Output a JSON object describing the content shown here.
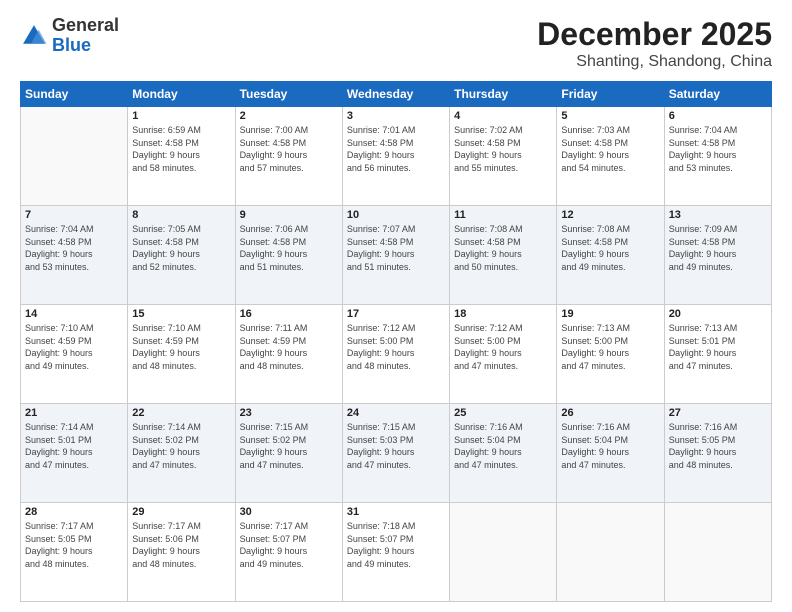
{
  "header": {
    "logo_general": "General",
    "logo_blue": "Blue",
    "main_title": "December 2025",
    "subtitle": "Shanting, Shandong, China"
  },
  "columns": [
    "Sunday",
    "Monday",
    "Tuesday",
    "Wednesday",
    "Thursday",
    "Friday",
    "Saturday"
  ],
  "weeks": [
    [
      {
        "day": "",
        "info": ""
      },
      {
        "day": "1",
        "info": "Sunrise: 6:59 AM\nSunset: 4:58 PM\nDaylight: 9 hours\nand 58 minutes."
      },
      {
        "day": "2",
        "info": "Sunrise: 7:00 AM\nSunset: 4:58 PM\nDaylight: 9 hours\nand 57 minutes."
      },
      {
        "day": "3",
        "info": "Sunrise: 7:01 AM\nSunset: 4:58 PM\nDaylight: 9 hours\nand 56 minutes."
      },
      {
        "day": "4",
        "info": "Sunrise: 7:02 AM\nSunset: 4:58 PM\nDaylight: 9 hours\nand 55 minutes."
      },
      {
        "day": "5",
        "info": "Sunrise: 7:03 AM\nSunset: 4:58 PM\nDaylight: 9 hours\nand 54 minutes."
      },
      {
        "day": "6",
        "info": "Sunrise: 7:04 AM\nSunset: 4:58 PM\nDaylight: 9 hours\nand 53 minutes."
      }
    ],
    [
      {
        "day": "7",
        "info": "Sunrise: 7:04 AM\nSunset: 4:58 PM\nDaylight: 9 hours\nand 53 minutes."
      },
      {
        "day": "8",
        "info": "Sunrise: 7:05 AM\nSunset: 4:58 PM\nDaylight: 9 hours\nand 52 minutes."
      },
      {
        "day": "9",
        "info": "Sunrise: 7:06 AM\nSunset: 4:58 PM\nDaylight: 9 hours\nand 51 minutes."
      },
      {
        "day": "10",
        "info": "Sunrise: 7:07 AM\nSunset: 4:58 PM\nDaylight: 9 hours\nand 51 minutes."
      },
      {
        "day": "11",
        "info": "Sunrise: 7:08 AM\nSunset: 4:58 PM\nDaylight: 9 hours\nand 50 minutes."
      },
      {
        "day": "12",
        "info": "Sunrise: 7:08 AM\nSunset: 4:58 PM\nDaylight: 9 hours\nand 49 minutes."
      },
      {
        "day": "13",
        "info": "Sunrise: 7:09 AM\nSunset: 4:58 PM\nDaylight: 9 hours\nand 49 minutes."
      }
    ],
    [
      {
        "day": "14",
        "info": "Sunrise: 7:10 AM\nSunset: 4:59 PM\nDaylight: 9 hours\nand 49 minutes."
      },
      {
        "day": "15",
        "info": "Sunrise: 7:10 AM\nSunset: 4:59 PM\nDaylight: 9 hours\nand 48 minutes."
      },
      {
        "day": "16",
        "info": "Sunrise: 7:11 AM\nSunset: 4:59 PM\nDaylight: 9 hours\nand 48 minutes."
      },
      {
        "day": "17",
        "info": "Sunrise: 7:12 AM\nSunset: 5:00 PM\nDaylight: 9 hours\nand 48 minutes."
      },
      {
        "day": "18",
        "info": "Sunrise: 7:12 AM\nSunset: 5:00 PM\nDaylight: 9 hours\nand 47 minutes."
      },
      {
        "day": "19",
        "info": "Sunrise: 7:13 AM\nSunset: 5:00 PM\nDaylight: 9 hours\nand 47 minutes."
      },
      {
        "day": "20",
        "info": "Sunrise: 7:13 AM\nSunset: 5:01 PM\nDaylight: 9 hours\nand 47 minutes."
      }
    ],
    [
      {
        "day": "21",
        "info": "Sunrise: 7:14 AM\nSunset: 5:01 PM\nDaylight: 9 hours\nand 47 minutes."
      },
      {
        "day": "22",
        "info": "Sunrise: 7:14 AM\nSunset: 5:02 PM\nDaylight: 9 hours\nand 47 minutes."
      },
      {
        "day": "23",
        "info": "Sunrise: 7:15 AM\nSunset: 5:02 PM\nDaylight: 9 hours\nand 47 minutes."
      },
      {
        "day": "24",
        "info": "Sunrise: 7:15 AM\nSunset: 5:03 PM\nDaylight: 9 hours\nand 47 minutes."
      },
      {
        "day": "25",
        "info": "Sunrise: 7:16 AM\nSunset: 5:04 PM\nDaylight: 9 hours\nand 47 minutes."
      },
      {
        "day": "26",
        "info": "Sunrise: 7:16 AM\nSunset: 5:04 PM\nDaylight: 9 hours\nand 47 minutes."
      },
      {
        "day": "27",
        "info": "Sunrise: 7:16 AM\nSunset: 5:05 PM\nDaylight: 9 hours\nand 48 minutes."
      }
    ],
    [
      {
        "day": "28",
        "info": "Sunrise: 7:17 AM\nSunset: 5:05 PM\nDaylight: 9 hours\nand 48 minutes."
      },
      {
        "day": "29",
        "info": "Sunrise: 7:17 AM\nSunset: 5:06 PM\nDaylight: 9 hours\nand 48 minutes."
      },
      {
        "day": "30",
        "info": "Sunrise: 7:17 AM\nSunset: 5:07 PM\nDaylight: 9 hours\nand 49 minutes."
      },
      {
        "day": "31",
        "info": "Sunrise: 7:18 AM\nSunset: 5:07 PM\nDaylight: 9 hours\nand 49 minutes."
      },
      {
        "day": "",
        "info": ""
      },
      {
        "day": "",
        "info": ""
      },
      {
        "day": "",
        "info": ""
      }
    ]
  ]
}
